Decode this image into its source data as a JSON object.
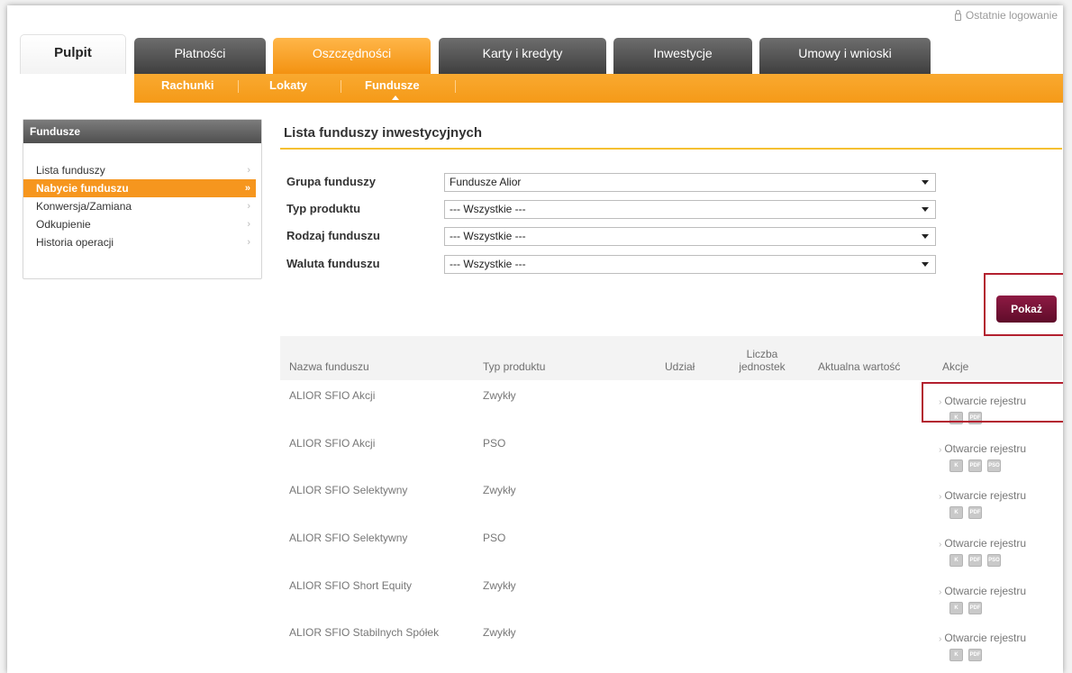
{
  "header": {
    "last_login": "Ostatnie logowanie"
  },
  "tabs": [
    {
      "label": "Pulpit"
    },
    {
      "label": "Płatności"
    },
    {
      "label": "Oszczędności"
    },
    {
      "label": "Karty i kredyty"
    },
    {
      "label": "Inwestycje"
    },
    {
      "label": "Umowy i wnioski"
    }
  ],
  "subnav": [
    {
      "label": "Rachunki"
    },
    {
      "label": "Lokaty"
    },
    {
      "label": "Fundusze"
    }
  ],
  "sidebar": {
    "title": "Fundusze",
    "items": [
      {
        "label": "Lista funduszy",
        "arrow": "›"
      },
      {
        "label": "Nabycie funduszu",
        "arrow": "»"
      },
      {
        "label": "Konwersja/Zamiana",
        "arrow": "›"
      },
      {
        "label": "Odkupienie",
        "arrow": "›"
      },
      {
        "label": "Historia operacji",
        "arrow": "›"
      }
    ]
  },
  "main": {
    "title": "Lista funduszy inwestycyjnych",
    "filters": [
      {
        "label": "Grupa funduszy",
        "value": "Fundusze Alior"
      },
      {
        "label": "Typ produktu",
        "value": "--- Wszystkie ---"
      },
      {
        "label": "Rodzaj funduszu",
        "value": "--- Wszystkie ---"
      },
      {
        "label": "Waluta funduszu",
        "value": "--- Wszystkie ---"
      }
    ],
    "show_button": "Pokaż"
  },
  "table": {
    "columns": {
      "name": "Nazwa funduszu",
      "type": "Typ produktu",
      "share": "Udział",
      "units_line1": "Liczba",
      "units_line2": "jednostek",
      "value": "Aktualna wartość",
      "actions": "Akcje"
    },
    "action_label": "Otwarcie rejestru",
    "rows": [
      {
        "name": "ALIOR SFIO Akcji",
        "type": "Zwykły",
        "icons": [
          "K",
          "PDF"
        ]
      },
      {
        "name": "ALIOR SFIO Akcji",
        "type": "PSO",
        "icons": [
          "K",
          "PDF",
          "PSO"
        ]
      },
      {
        "name": "ALIOR SFIO Selektywny",
        "type": "Zwykły",
        "icons": [
          "K",
          "PDF"
        ]
      },
      {
        "name": "ALIOR SFIO Selektywny",
        "type": "PSO",
        "icons": [
          "K",
          "PDF",
          "PSO"
        ]
      },
      {
        "name": "ALIOR SFIO Short Equity",
        "type": "Zwykły",
        "icons": [
          "K",
          "PDF"
        ]
      },
      {
        "name": "ALIOR SFIO Stabilnych Spółek",
        "type": "Zwykły",
        "icons": [
          "K",
          "PDF"
        ]
      }
    ]
  }
}
